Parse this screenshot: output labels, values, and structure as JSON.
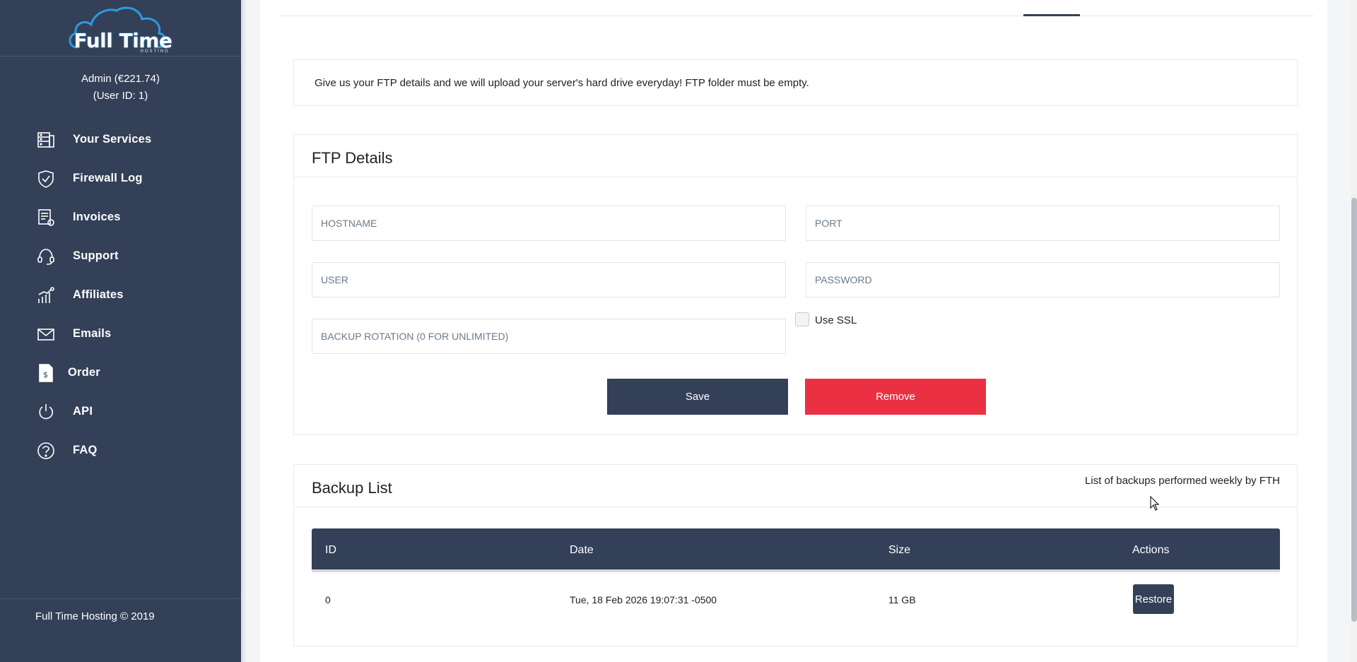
{
  "brand": {
    "name": "Full Time",
    "tagline": "HOSTING",
    "footer": "Full Time Hosting © 2019"
  },
  "user": {
    "line1": "Admin (€221.74)",
    "line2": "(User ID: 1)"
  },
  "nav": [
    {
      "label": "Your Services",
      "icon": "servers-icon"
    },
    {
      "label": "Firewall Log",
      "icon": "shield-icon"
    },
    {
      "label": "Invoices",
      "icon": "invoice-icon"
    },
    {
      "label": "Support",
      "icon": "headset-icon"
    },
    {
      "label": "Affiliates",
      "icon": "growth-chart-icon"
    },
    {
      "label": "Emails",
      "icon": "envelope-icon"
    },
    {
      "label": "Order",
      "icon": "order-document-icon"
    },
    {
      "label": "API",
      "icon": "power-icon"
    },
    {
      "label": "FAQ",
      "icon": "question-icon"
    }
  ],
  "notice": "Give us your FTP details and we will upload your server's hard drive everyday! FTP folder must be empty.",
  "ftp": {
    "title": "FTP Details",
    "hostname_placeholder": "HOSTNAME",
    "port_placeholder": "PORT",
    "user_placeholder": "USER",
    "password_placeholder": "PASSWORD",
    "rotation_placeholder": "BACKUP ROTATION (0 FOR UNLIMITED)",
    "ssl_label": "Use SSL",
    "save_label": "Save",
    "remove_label": "Remove"
  },
  "backups": {
    "title": "Backup List",
    "subtitle": "List of backups performed weekly by FTH",
    "columns": [
      "ID",
      "Date",
      "Size",
      "Actions"
    ],
    "rows": [
      {
        "id": "0",
        "date": "Tue, 18 Feb 2026 19:07:31 -0500",
        "size": "11 GB",
        "action": "Restore"
      }
    ]
  },
  "colors": {
    "sidebar": "#344058",
    "primary": "#344058",
    "danger": "#ec3044"
  }
}
